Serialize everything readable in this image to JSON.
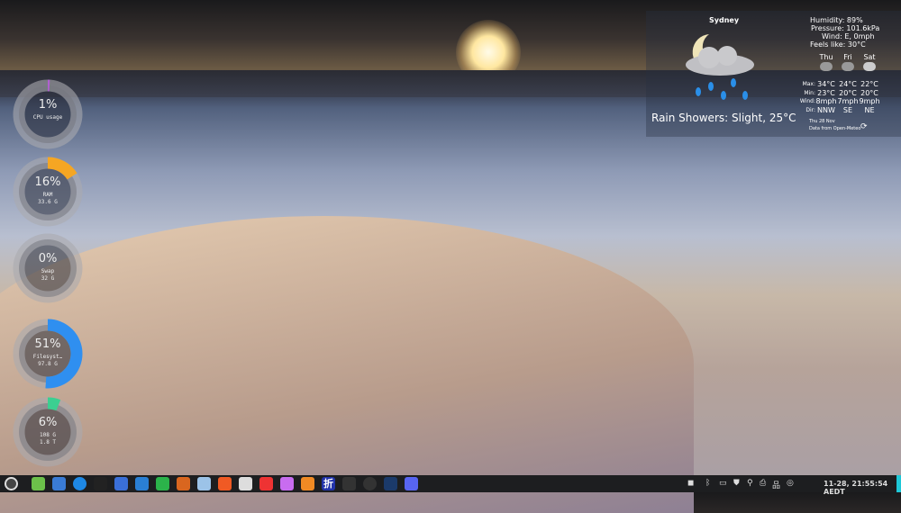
{
  "weather": {
    "city": "Sydney",
    "humidity": "Humidity: 89%",
    "pressure": "Pressure: 101.6kPa",
    "wind": "Wind: E, 0mph",
    "feels": "Feels like: 30°C",
    "condition": "Rain Showers: Slight, 25°C",
    "row_labels": [
      "Max:",
      "Min:",
      "Wind:",
      "Dir:"
    ],
    "days": [
      {
        "name": "Thu",
        "max": "34°C",
        "min": "23°C",
        "wind": "8mph",
        "dir": "NNW"
      },
      {
        "name": "Fri",
        "max": "24°C",
        "min": "20°C",
        "wind": "7mph",
        "dir": "SE"
      },
      {
        "name": "Sat",
        "max": "22°C",
        "min": "20°C",
        "wind": "9mph",
        "dir": "NE"
      }
    ],
    "date": "Thu 28 Nov",
    "source": "Data from Open-Meteo"
  },
  "gauges": [
    {
      "pct": "1%",
      "value": 1,
      "l1": "CPU usage",
      "l2": "",
      "color": "#b060d0"
    },
    {
      "pct": "16%",
      "value": 16,
      "l1": "RAM",
      "l2": "33.6 G",
      "color": "#f5a623"
    },
    {
      "pct": "0%",
      "value": 0,
      "l1": "Swap",
      "l2": "32 G",
      "color": "#888888"
    },
    {
      "pct": "51%",
      "value": 51,
      "l1": "Filesyst…",
      "l2": "97.8 G",
      "color": "#2f8ff0"
    },
    {
      "pct": "6%",
      "value": 6,
      "l1": "108 G",
      "l2": "1.8 T",
      "color": "#3ccf91"
    }
  ],
  "taskbar": {
    "apps": [
      {
        "name": "menu",
        "color": "#444"
      },
      {
        "name": "globe",
        "color": "#6cc04a"
      },
      {
        "name": "settings",
        "color": "#3a7bd5"
      },
      {
        "name": "browser",
        "color": "#1e88e5"
      },
      {
        "name": "terminal",
        "color": "#222"
      },
      {
        "name": "mail",
        "color": "#3a6fd8"
      },
      {
        "name": "documents",
        "color": "#2a7fd4"
      },
      {
        "name": "spreadsheet",
        "color": "#2bb34a"
      },
      {
        "name": "presentation",
        "color": "#d9661f"
      },
      {
        "name": "files",
        "color": "#9cc3e8"
      },
      {
        "name": "brave",
        "color": "#f05a24"
      },
      {
        "name": "inkscape",
        "color": "#ddd"
      },
      {
        "name": "app-red",
        "color": "#e33"
      },
      {
        "name": "krita",
        "color": "#c86cf0"
      },
      {
        "name": "blender",
        "color": "#f08a24"
      },
      {
        "name": "zhe",
        "color": "#2233aa"
      },
      {
        "name": "video",
        "color": "#333"
      },
      {
        "name": "obs",
        "color": "#333"
      },
      {
        "name": "steam",
        "color": "#1b3a6a"
      },
      {
        "name": "discord",
        "color": "#5865f2"
      }
    ],
    "zhe_glyph": "折",
    "clock": "11-28, 21:55:54 AEDT",
    "accent": "#1ec8d8"
  }
}
